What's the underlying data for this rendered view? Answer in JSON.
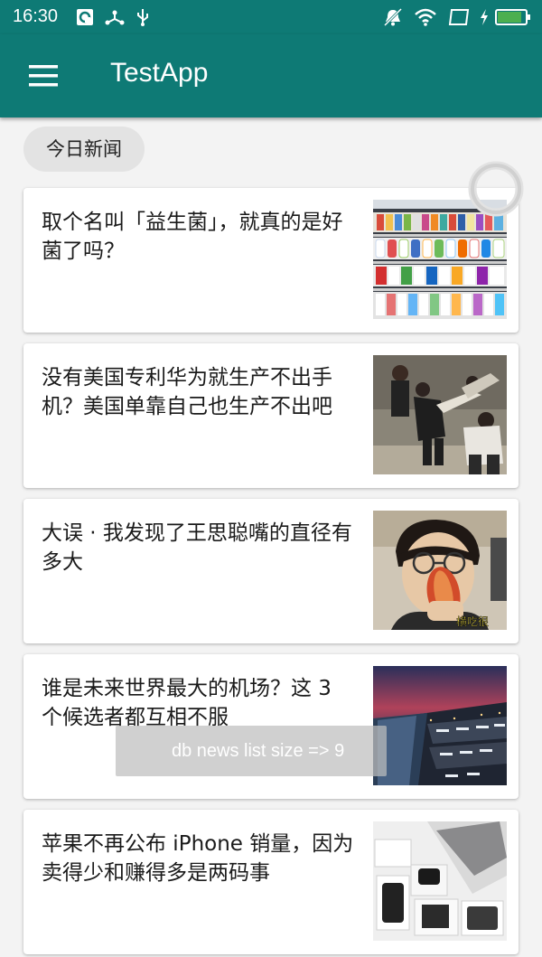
{
  "status_bar": {
    "time": "16:30",
    "icons": [
      "notification-app-icon",
      "usb-share-icon",
      "usb-icon",
      "silent-bell-icon",
      "wifi-icon",
      "sim-icon",
      "charging-icon",
      "battery-icon"
    ],
    "battery_level": 0.85,
    "battery_color": "#4caf50"
  },
  "app_bar": {
    "title": "TestApp",
    "menu_icon": "hamburger-menu-icon",
    "color": "#0e7a75"
  },
  "category_chip": "今日新闻",
  "loading_icon": "refresh-spinner-icon",
  "news": [
    {
      "title": "取个名叫「益生菌」，就真的是好菌了吗？",
      "thumb": "supermarket-shelves-image"
    },
    {
      "title": "没有美国专利华为就生产不出手机？美国单靠自己也生产不出吧",
      "thumb": "people-pulling-image"
    },
    {
      "title": "大误 · 我发现了王思聪嘴的直径有多大",
      "thumb": "man-eating-hotdog-image",
      "thumb_caption": "横吃很"
    },
    {
      "title": "谁是未来世界最大的机场？这 3 个候选者都互相不服",
      "thumb": "airport-aerial-image"
    },
    {
      "title": "苹果不再公布 iPhone 销量，因为卖得少和赚得多是两码事",
      "thumb": "apple-products-image"
    }
  ],
  "toast": "db news list size => 9"
}
